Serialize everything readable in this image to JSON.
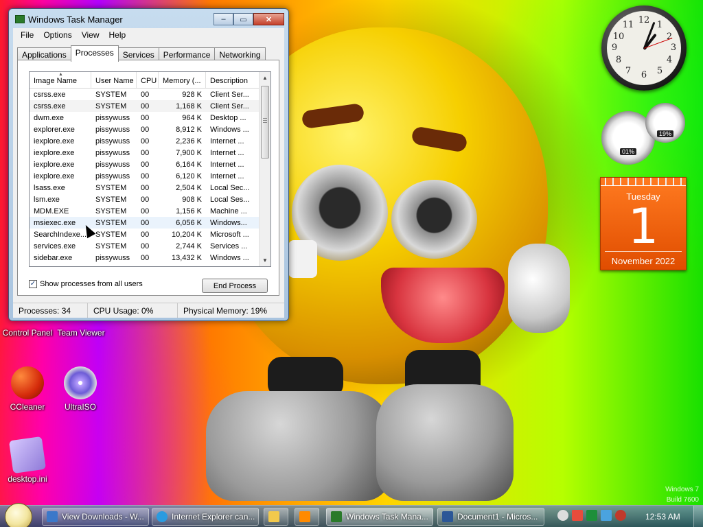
{
  "window": {
    "title": "Windows Task Manager",
    "controls": [
      "–",
      "▭",
      "✕"
    ],
    "menu": [
      "File",
      "Options",
      "View",
      "Help"
    ],
    "tabs": [
      "Applications",
      "Processes",
      "Services",
      "Performance",
      "Networking"
    ],
    "active_tab": "Processes"
  },
  "table": {
    "columns": [
      "Image Name",
      "User Name",
      "CPU",
      "Memory (...",
      "Description"
    ],
    "rows": [
      [
        "csrss.exe",
        "SYSTEM",
        "00",
        "928 K",
        "Client Ser..."
      ],
      [
        "csrss.exe",
        "SYSTEM",
        "00",
        "1,168 K",
        "Client Ser..."
      ],
      [
        "dwm.exe",
        "pissywuss",
        "00",
        "964 K",
        "Desktop ..."
      ],
      [
        "explorer.exe",
        "pissywuss",
        "00",
        "8,912 K",
        "Windows ..."
      ],
      [
        "iexplore.exe",
        "pissywuss",
        "00",
        "2,236 K",
        "Internet ..."
      ],
      [
        "iexplore.exe",
        "pissywuss",
        "00",
        "7,900 K",
        "Internet ..."
      ],
      [
        "iexplore.exe",
        "pissywuss",
        "00",
        "6,164 K",
        "Internet ..."
      ],
      [
        "iexplore.exe",
        "pissywuss",
        "00",
        "6,120 K",
        "Internet ..."
      ],
      [
        "lsass.exe",
        "SYSTEM",
        "00",
        "2,504 K",
        "Local Sec..."
      ],
      [
        "lsm.exe",
        "SYSTEM",
        "00",
        "908 K",
        "Local Ses..."
      ],
      [
        "MDM.EXE",
        "SYSTEM",
        "00",
        "1,156 K",
        "Machine ..."
      ],
      [
        "msiexec.exe",
        "SYSTEM",
        "00",
        "6,056 K",
        "Windows..."
      ],
      [
        "SearchIndexe...",
        "SYSTEM",
        "00",
        "10,204 K",
        "Microsoft ..."
      ],
      [
        "services.exe",
        "SYSTEM",
        "00",
        "2,744 K",
        "Services ..."
      ],
      [
        "sidebar.exe",
        "pissywuss",
        "00",
        "13,432 K",
        "Windows ..."
      ]
    ]
  },
  "options": {
    "show_all_label": "Show processes from all users",
    "show_all_checked": true,
    "end_process_label": "End Process"
  },
  "status": {
    "processes": "Processes: 34",
    "cpu": "CPU Usage: 0%",
    "memory": "Physical Memory: 19%"
  },
  "desktop_icons": [
    {
      "label": "Control Panel"
    },
    {
      "label": "Team Viewer"
    },
    {
      "label": "CCleaner"
    },
    {
      "label": "UltraISO"
    },
    {
      "label": "desktop.ini"
    }
  ],
  "gadgets": {
    "clock_numbers": [
      "12",
      "1",
      "2",
      "3",
      "4",
      "5",
      "6",
      "7",
      "8",
      "9",
      "10",
      "11"
    ],
    "cpu_meter": "01%",
    "memory_meter": "19%",
    "calendar": {
      "weekday": "Tuesday",
      "day": "1",
      "month_year": "November 2022"
    }
  },
  "watermark": {
    "line1": "Windows 7",
    "line2": "Build 7600"
  },
  "taskbar": {
    "buttons": [
      "View Downloads - W...",
      "Internet Explorer can...",
      "",
      "",
      "Windows Task Mana...",
      "Document1 - Micros..."
    ],
    "clock": "12:53 AM"
  },
  "colors": {
    "calendar_orange": "#e8590c",
    "title_bar": "#b8d0e8",
    "close_red": "#c4402a"
  }
}
